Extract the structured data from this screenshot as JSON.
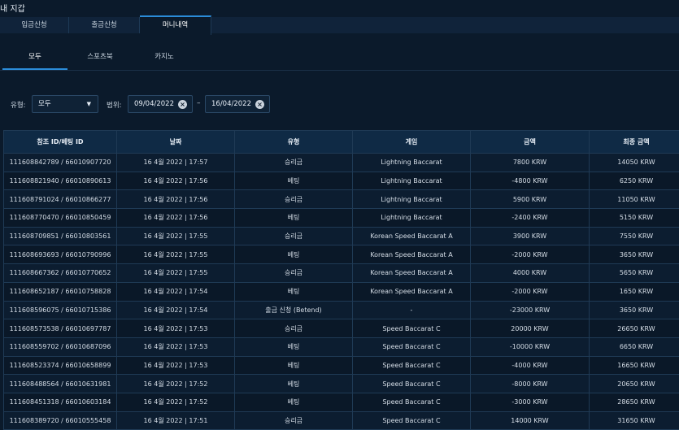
{
  "page": {
    "title": "내 지갑"
  },
  "main_tabs": [
    {
      "label": "입금신청",
      "active": false
    },
    {
      "label": "출금신청",
      "active": false
    },
    {
      "label": "머니내역",
      "active": true
    }
  ],
  "sub_tabs": [
    {
      "label": "모두",
      "active": true
    },
    {
      "label": "스포츠북",
      "active": false
    },
    {
      "label": "카지노",
      "active": false
    }
  ],
  "filters": {
    "type_label": "유형:",
    "type_value": "모두",
    "range_label": "범위:",
    "date_from": "09/04/2022",
    "date_to": "16/04/2022",
    "separator": "–"
  },
  "table": {
    "headers": [
      "참조 ID/베팅 ID",
      "날짜",
      "유형",
      "게임",
      "금액",
      "최종 금액"
    ],
    "rows": [
      [
        "111608842789 / 66010907720",
        "16 4월 2022 | 17:57",
        "승리금",
        "Lightning Baccarat",
        "7800 KRW",
        "14050 KRW"
      ],
      [
        "111608821940 / 66010890613",
        "16 4월 2022 | 17:56",
        "베팅",
        "Lightning Baccarat",
        "-4800 KRW",
        "6250 KRW"
      ],
      [
        "111608791024 / 66010866277",
        "16 4월 2022 | 17:56",
        "승리금",
        "Lightning Baccarat",
        "5900 KRW",
        "11050 KRW"
      ],
      [
        "111608770470 / 66010850459",
        "16 4월 2022 | 17:56",
        "베팅",
        "Lightning Baccarat",
        "-2400 KRW",
        "5150 KRW"
      ],
      [
        "111608709851 / 66010803561",
        "16 4월 2022 | 17:55",
        "승리금",
        "Korean Speed Baccarat A",
        "3900 KRW",
        "7550 KRW"
      ],
      [
        "111608693693 / 66010790996",
        "16 4월 2022 | 17:55",
        "베팅",
        "Korean Speed Baccarat A",
        "-2000 KRW",
        "3650 KRW"
      ],
      [
        "111608667362 / 66010770652",
        "16 4월 2022 | 17:55",
        "승리금",
        "Korean Speed Baccarat A",
        "4000 KRW",
        "5650 KRW"
      ],
      [
        "111608652187 / 66010758828",
        "16 4월 2022 | 17:54",
        "베팅",
        "Korean Speed Baccarat A",
        "-2000 KRW",
        "1650 KRW"
      ],
      [
        "111608596075 / 66010715386",
        "16 4월 2022 | 17:54",
        "출금 신청 (Betend)",
        "-",
        "-23000 KRW",
        "3650 KRW"
      ],
      [
        "111608573538 / 66010697787",
        "16 4월 2022 | 17:53",
        "승리금",
        "Speed Baccarat C",
        "20000 KRW",
        "26650 KRW"
      ],
      [
        "111608559702 / 66010687096",
        "16 4월 2022 | 17:53",
        "베팅",
        "Speed Baccarat C",
        "-10000 KRW",
        "6650 KRW"
      ],
      [
        "111608523374 / 66010658899",
        "16 4월 2022 | 17:53",
        "베팅",
        "Speed Baccarat C",
        "-4000 KRW",
        "16650 KRW"
      ],
      [
        "111608488564 / 66010631981",
        "16 4월 2022 | 17:52",
        "베팅",
        "Speed Baccarat C",
        "-8000 KRW",
        "20650 KRW"
      ],
      [
        "111608451318 / 66010603184",
        "16 4월 2022 | 17:52",
        "베팅",
        "Speed Baccarat C",
        "-3000 KRW",
        "28650 KRW"
      ],
      [
        "111608389720 / 66010555458",
        "16 4월 2022 | 17:51",
        "승리금",
        "Speed Baccarat C",
        "14000 KRW",
        "31650 KRW"
      ]
    ]
  },
  "icons": {
    "dropdown": "chevron-down-icon",
    "clear": "clear-icon"
  }
}
